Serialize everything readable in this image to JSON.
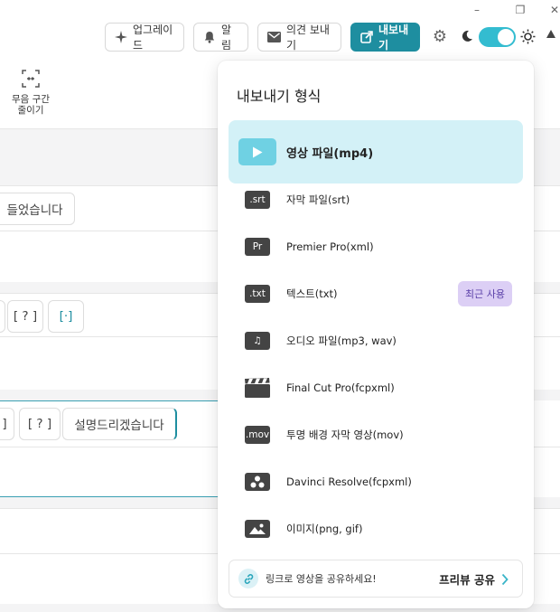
{
  "window": {
    "minimize": "–",
    "maximize": "❐",
    "close": "✕"
  },
  "toolbar": {
    "upgrade": "업그레이드",
    "alarm": "알림",
    "feedback": "의견 보내기",
    "export": "내보내기"
  },
  "left_tool": {
    "label_line1": "무음 구간",
    "label_line2": "줄이기"
  },
  "editor": {
    "chip1": "들었습니다",
    "chip2": "[ ? ]",
    "chip3": "[·]",
    "chip4": "]",
    "chip5": "[ ? ]",
    "chip6": "설명드리겠습니다"
  },
  "export_menu": {
    "title": "내보내기 형식",
    "items": [
      {
        "badge": "▶",
        "label": "영상 파일(mp4)",
        "icon": "play-icon"
      },
      {
        "badge": ".srt",
        "label": "자막 파일(srt)",
        "icon": "srt-icon"
      },
      {
        "badge": "Pr",
        "label": "Premier Pro(xml)",
        "icon": "premiere-icon"
      },
      {
        "badge": ".txt",
        "label": "텍스트(txt)",
        "icon": "txt-icon",
        "tag": "최근 사용"
      },
      {
        "badge": "♫",
        "label": "오디오 파일(mp3, wav)",
        "icon": "music-icon"
      },
      {
        "badge": "",
        "label": "Final Cut Pro(fcpxml)",
        "icon": "clapper-icon"
      },
      {
        "badge": ".mov",
        "label": "투명 배경 자막 영상(mov)",
        "icon": "mov-icon"
      },
      {
        "badge": "",
        "label": "Davinci Resolve(fcpxml)",
        "icon": "davinci-icon"
      },
      {
        "badge": "",
        "label": "이미지(png, gif)",
        "icon": "image-icon"
      }
    ],
    "share": {
      "text": "링크로 영상을 공유하세요!",
      "action": "프리뷰 공유"
    }
  },
  "colors": {
    "accent": "#1e8ea0",
    "selected_bg": "#d3f1f7",
    "recent_bg": "#dccff5"
  }
}
